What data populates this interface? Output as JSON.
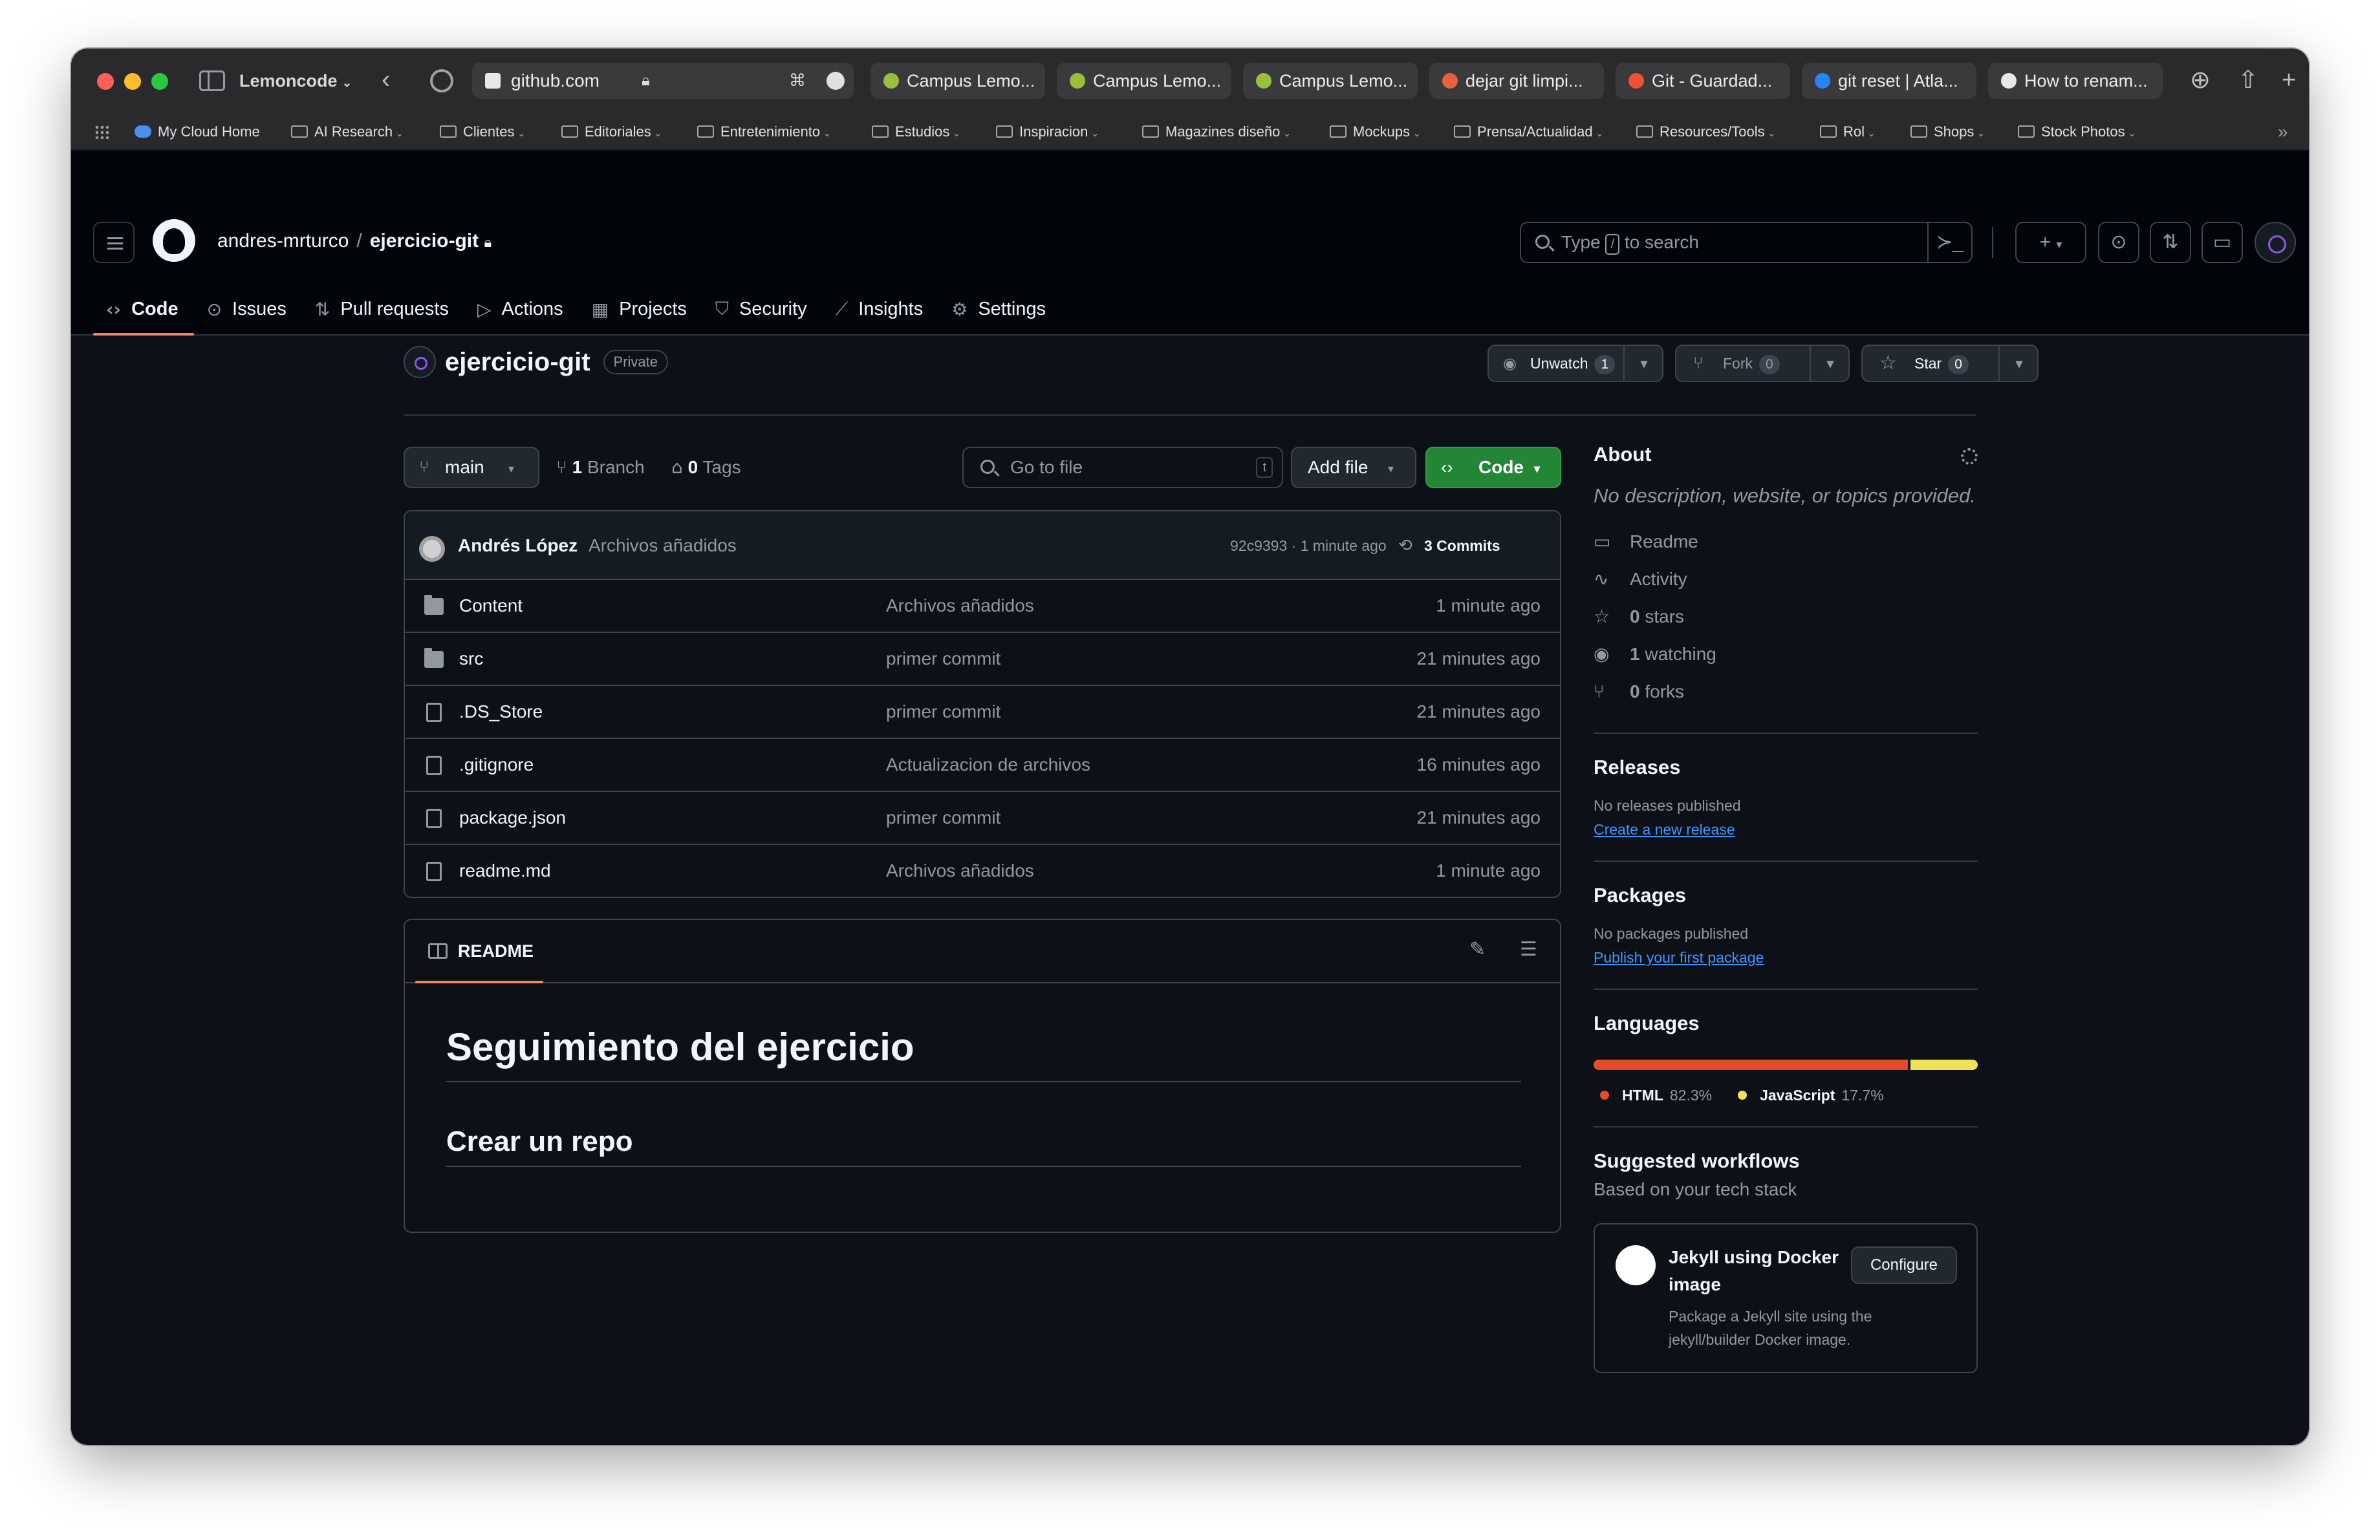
{
  "browser": {
    "profile": "Lemoncode",
    "url": "github.com",
    "tabs": [
      {
        "label": "Campus Lemo...",
        "color": "#9bbf3a"
      },
      {
        "label": "Campus Lemo...",
        "color": "#9bbf3a"
      },
      {
        "label": "Campus Lemo...",
        "color": "#9bbf3a"
      },
      {
        "label": "dejar git limpi...",
        "color": "#e8603c"
      },
      {
        "label": "Git - Guardad...",
        "color": "#f05033"
      },
      {
        "label": "git reset | Atla...",
        "color": "#2684ff"
      },
      {
        "label": "How to renam...",
        "color": "#e8e8e8"
      }
    ],
    "bookmarks": [
      {
        "label": "My Cloud Home"
      },
      {
        "label": "AI Research"
      },
      {
        "label": "Clientes"
      },
      {
        "label": "Editoriales"
      },
      {
        "label": "Entretenimiento"
      },
      {
        "label": "Estudios"
      },
      {
        "label": "Inspiracion"
      },
      {
        "label": "Magazines diseño"
      },
      {
        "label": "Mockups"
      },
      {
        "label": "Prensa/Actualidad"
      },
      {
        "label": "Resources/Tools"
      },
      {
        "label": "Rol"
      },
      {
        "label": "Shops"
      },
      {
        "label": "Stock Photos"
      }
    ]
  },
  "header": {
    "owner": "andres-mrturco",
    "separator": "/",
    "repo": "ejercicio-git",
    "search_prefix": "Type",
    "search_key": "/",
    "search_suffix": "to search"
  },
  "nav": [
    {
      "label": "Code",
      "icon": "code-icon",
      "glyph": "‹›",
      "active": true
    },
    {
      "label": "Issues",
      "icon": "issue-icon",
      "glyph": "⊙"
    },
    {
      "label": "Pull requests",
      "icon": "pull-request-icon",
      "glyph": "⇅"
    },
    {
      "label": "Actions",
      "icon": "play-icon",
      "glyph": "▷"
    },
    {
      "label": "Projects",
      "icon": "table-icon",
      "glyph": "▦"
    },
    {
      "label": "Security",
      "icon": "shield-icon",
      "glyph": "⛉"
    },
    {
      "label": "Insights",
      "icon": "graph-icon",
      "glyph": "⟋"
    },
    {
      "label": "Settings",
      "icon": "gear-icon",
      "glyph": "⚙"
    }
  ],
  "repo": {
    "name": "ejercicio-git",
    "visibility": "Private",
    "unwatch_label": "Unwatch",
    "unwatch_count": "1",
    "fork_label": "Fork",
    "fork_count": "0",
    "star_label": "Star",
    "star_count": "0"
  },
  "branchbar": {
    "branch": "main",
    "branches_count": "1",
    "branches_label": "Branch",
    "tags_count": "0",
    "tags_label": "Tags",
    "goto_placeholder": "Go to file",
    "goto_key": "t",
    "add_file": "Add file",
    "code": "Code"
  },
  "commit": {
    "author": "Andrés López",
    "message": "Archivos añadidos",
    "sha_time": "92c9393 · 1 minute ago",
    "commits": "3 Commits"
  },
  "files": [
    {
      "name": "Content",
      "type": "folder",
      "message": "Archivos añadidos",
      "time": "1 minute ago"
    },
    {
      "name": "src",
      "type": "folder",
      "message": "primer commit",
      "time": "21 minutes ago"
    },
    {
      "name": ".DS_Store",
      "type": "file",
      "message": "primer commit",
      "time": "21 minutes ago"
    },
    {
      "name": ".gitignore",
      "type": "file",
      "message": "Actualizacion de archivos",
      "time": "16 minutes ago"
    },
    {
      "name": "package.json",
      "type": "file",
      "message": "primer commit",
      "time": "21 minutes ago"
    },
    {
      "name": "readme.md",
      "type": "file",
      "message": "Archivos añadidos",
      "time": "1 minute ago"
    }
  ],
  "readme": {
    "tab": "README",
    "h1": "Seguimiento del ejercicio",
    "h2": "Crear un repo"
  },
  "about": {
    "title": "About",
    "description": "No description, website, or topics provided.",
    "items": [
      {
        "icon": "book-icon",
        "glyph": "▭",
        "count": "",
        "label": "Readme"
      },
      {
        "icon": "pulse-icon",
        "glyph": "∿",
        "count": "",
        "label": "Activity"
      },
      {
        "icon": "star-icon",
        "glyph": "☆",
        "count": "0",
        "label": "stars"
      },
      {
        "icon": "eye-icon",
        "glyph": "◉",
        "count": "1",
        "label": "watching"
      },
      {
        "icon": "fork-icon",
        "glyph": "⑂",
        "count": "0",
        "label": "forks"
      }
    ]
  },
  "releases": {
    "title": "Releases",
    "status": "No releases published",
    "link": "Create a new release"
  },
  "packages": {
    "title": "Packages",
    "status": "No packages published",
    "link": "Publish your first package"
  },
  "languages": {
    "title": "Languages",
    "items": [
      {
        "name": "HTML",
        "percent": "82.3%",
        "color": "#e34c26"
      },
      {
        "name": "JavaScript",
        "percent": "17.7%",
        "color": "#f1e05a"
      }
    ]
  },
  "workflows": {
    "title": "Suggested workflows",
    "subtitle": "Based on your tech stack",
    "card_title": "Jekyll using Docker image",
    "configure": "Configure",
    "card_desc": "Package a Jekyll site using the jekyll/builder Docker image."
  }
}
